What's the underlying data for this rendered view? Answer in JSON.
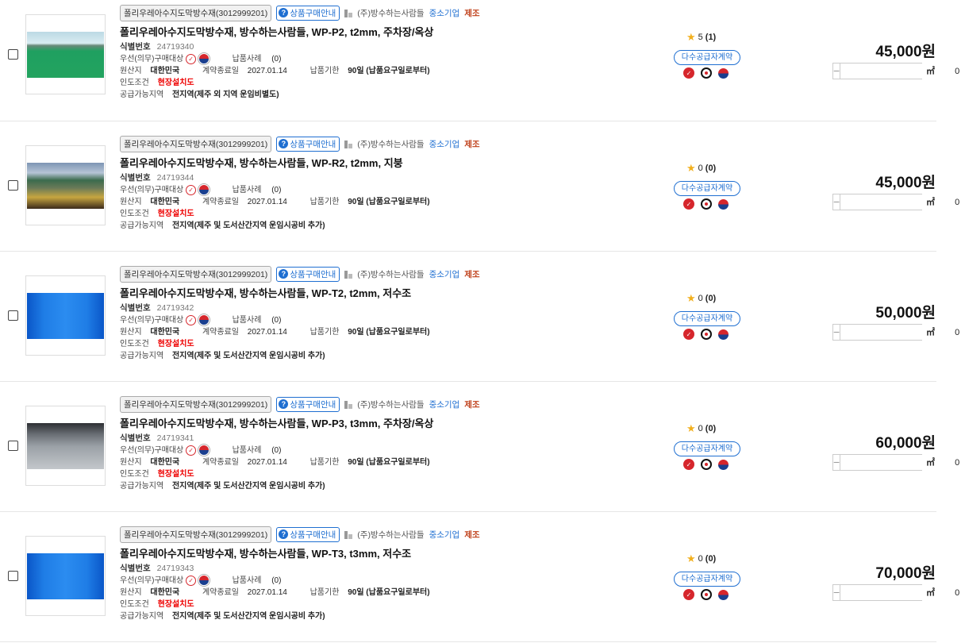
{
  "common": {
    "category_tag": "폴리우레아수지도막방수재(3012999201)",
    "guide_tag": "상품구매안내",
    "company": "(주)방수하는사람들",
    "sme": "중소기업",
    "mfg": "제조",
    "id_label": "식별번호",
    "priority_label": "우선(의무)구매대상",
    "delivery_case_label": "납품사례",
    "origin_label": "원산지",
    "origin_value": "대한민국",
    "contract_end_label": "계약종료일",
    "contract_end_value": "2027.01.14",
    "deadline_label": "납품기한",
    "deadline_value": "90일 (납품요구일로부터)",
    "delivery_cond_label": "인도조건",
    "delivery_cond_value": "현장설치도",
    "supply_area_label": "공급가능지역",
    "contract_button": "다수공급자계약",
    "unit": "㎡",
    "qty_minus": "−",
    "qty_plus": "+",
    "colors": {
      "accent": "#1f6fd1",
      "price": "#111111",
      "alert": "#e00000"
    }
  },
  "products": [
    {
      "title": "폴리우레아수지도막방수재, 방수하는사람들, WP-P2, t2mm, 주차장/옥상",
      "id": "24719340",
      "delivery_cases": "(0)",
      "supply_area": "전지역(제주 외 지역 운임비별도)",
      "rating": "5",
      "rating_count": "(1)",
      "price": "45,000원",
      "qty": "0",
      "image": "green-rooftop"
    },
    {
      "title": "폴리우레아수지도막방수재, 방수하는사람들, WP-R2, t2mm, 지붕",
      "id": "24719344",
      "delivery_cases": "(0)",
      "supply_area": "전지역(제주 및 도서산간지역 운임시공비 추가)",
      "rating": "0",
      "rating_count": "(0)",
      "price": "45,000원",
      "qty": "0",
      "image": "roof-building"
    },
    {
      "title": "폴리우레아수지도막방수재, 방수하는사람들, WP-T2, t2mm, 저수조",
      "id": "24719342",
      "delivery_cases": "(0)",
      "supply_area": "전지역(제주 및 도서산간지역 운임시공비 추가)",
      "rating": "0",
      "rating_count": "(0)",
      "price": "50,000원",
      "qty": "0",
      "image": "blue-tank"
    },
    {
      "title": "폴리우레아수지도막방수재, 방수하는사람들, WP-P3, t3mm, 주차장/옥상",
      "id": "24719341",
      "delivery_cases": "(0)",
      "supply_area": "전지역(제주 및 도서산간지역 운임시공비 추가)",
      "rating": "0",
      "rating_count": "(0)",
      "price": "60,000원",
      "qty": "0",
      "image": "gray-parking"
    },
    {
      "title": "폴리우레아수지도막방수재, 방수하는사람들, WP-T3, t3mm, 저수조",
      "id": "24719343",
      "delivery_cases": "(0)",
      "supply_area": "전지역(제주 및 도서산간지역 운임시공비 추가)",
      "rating": "0",
      "rating_count": "(0)",
      "price": "70,000원",
      "qty": "0",
      "image": "blue-tank"
    }
  ]
}
